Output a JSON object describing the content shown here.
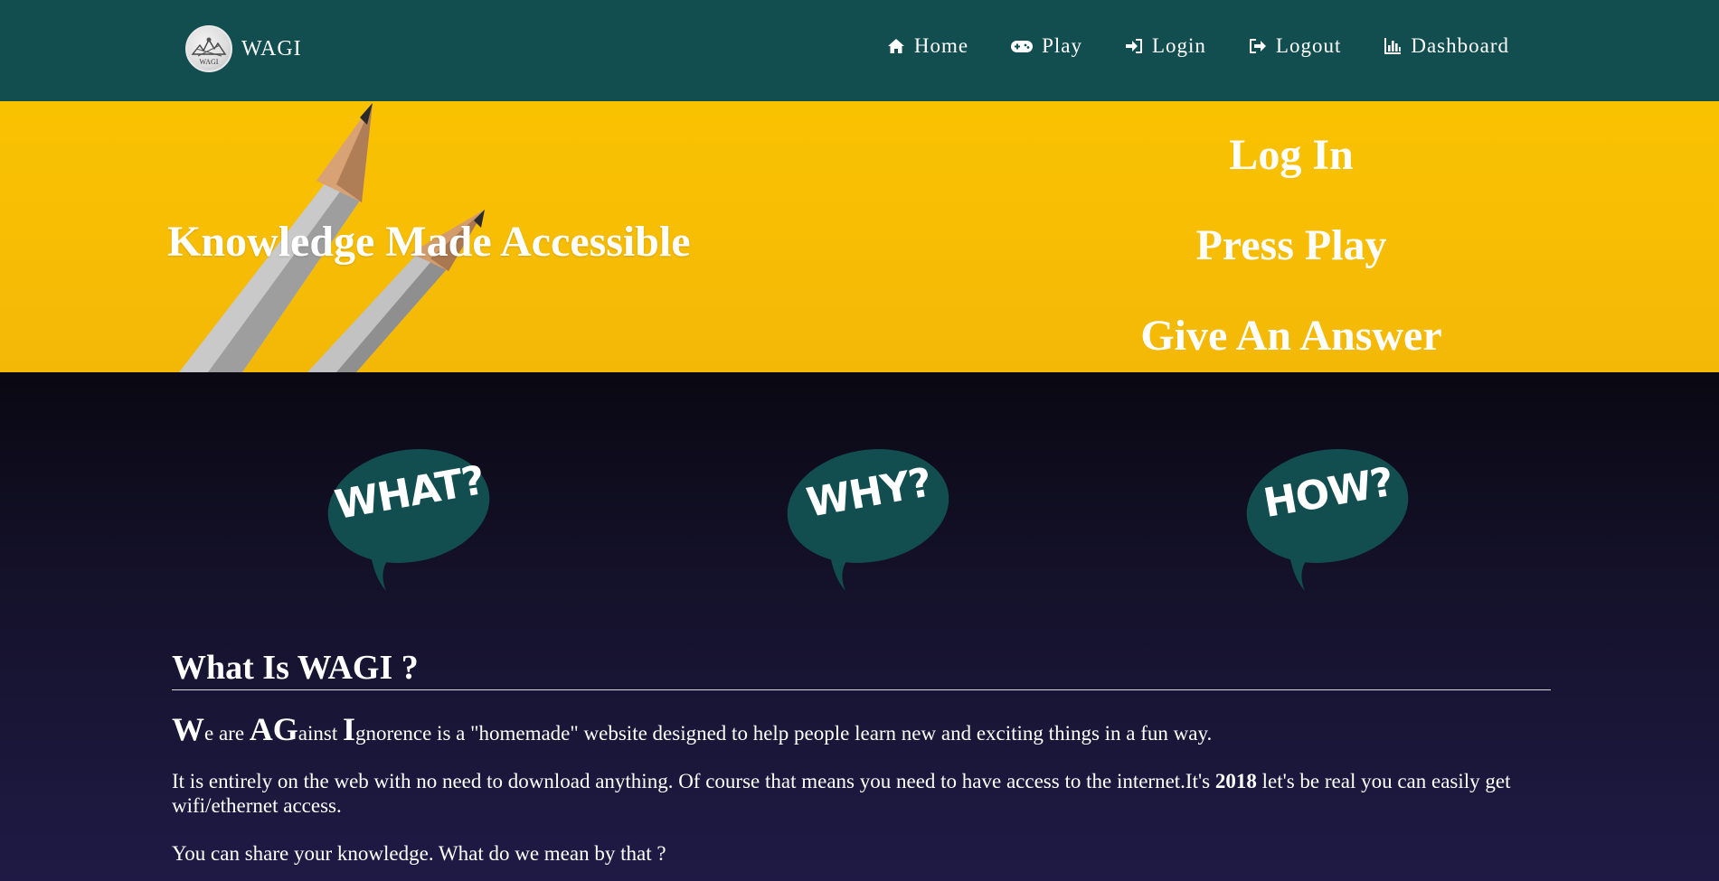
{
  "navbar": {
    "brand": {
      "name": "WAGI",
      "logo_text": "WAGI",
      "logo_icon": "wagi-logo"
    },
    "links": [
      {
        "label": "Home",
        "icon": "home-icon"
      },
      {
        "label": "Play",
        "icon": "gamepad-icon"
      },
      {
        "label": "Login",
        "icon": "sign-in-icon"
      },
      {
        "label": "Logout",
        "icon": "sign-out-icon"
      },
      {
        "label": "Dashboard",
        "icon": "bar-chart-icon"
      }
    ]
  },
  "hero": {
    "tagline": "Knowledge Made Accessible",
    "steps": [
      "Log In",
      "Press Play",
      "Give An Answer"
    ]
  },
  "bubbles": [
    "WHAT?",
    "WHY?",
    "HOW?"
  ],
  "about": {
    "title": "What Is WAGI ?",
    "intro": {
      "w": "W",
      "w_rest": "e are ",
      "ag": "AG",
      "ag_rest": "ainst ",
      "i": "I",
      "i_rest": "gnorence is a \"homemade\" website designed to help people learn new and exciting things in a fun way."
    },
    "para2": {
      "before": "It is entirely on the web with no need to download anything. Of course that means you need to have access to the internet.It's ",
      "year": "2018",
      "after": " let's be real you can easily get wifi/ethernet access."
    },
    "para3": "You can share your knowledge. What do we mean by that ?"
  },
  "colors": {
    "navbar": "#124e4f",
    "hero": "#f9c200",
    "bubble": "#124e4f",
    "dark_bg_top": "#0a0812",
    "dark_bg_bottom": "#1f1a45"
  }
}
